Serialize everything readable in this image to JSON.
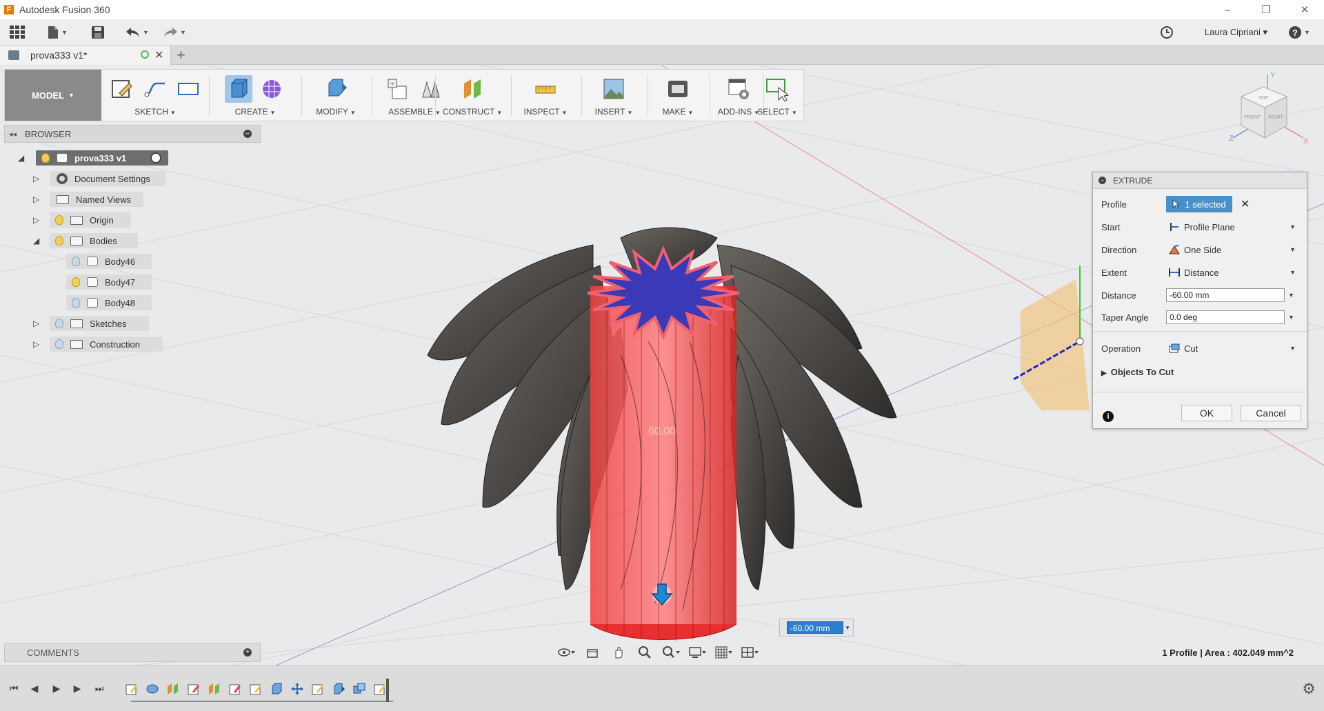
{
  "app": {
    "title": "Autodesk Fusion 360",
    "logo_letter": "F",
    "window_buttons": [
      "–",
      "❐",
      "✕"
    ]
  },
  "quickbar": {
    "user_name": "Laura Cipriani ▾",
    "icons": [
      "app-grid-icon",
      "file-icon",
      "save-icon",
      "undo-icon",
      "redo-icon",
      "job-status-icon",
      "help-icon"
    ]
  },
  "tab": {
    "label": "prova333 v1*",
    "new_tab": "+"
  },
  "ribbon": {
    "workspace": "MODEL",
    "groups": [
      {
        "id": "sketch",
        "label": "SKETCH"
      },
      {
        "id": "create",
        "label": "CREATE"
      },
      {
        "id": "modify",
        "label": "MODIFY"
      },
      {
        "id": "assemble",
        "label": "ASSEMBLE"
      },
      {
        "id": "construct",
        "label": "CONSTRUCT"
      },
      {
        "id": "inspect",
        "label": "INSPECT"
      },
      {
        "id": "insert",
        "label": "INSERT"
      },
      {
        "id": "make",
        "label": "MAKE"
      },
      {
        "id": "addins",
        "label": "ADD-INS"
      },
      {
        "id": "select",
        "label": "SELECT"
      }
    ]
  },
  "browser": {
    "title": "BROWSER",
    "root": "prova333 v1",
    "items": [
      {
        "label": "Document Settings"
      },
      {
        "label": "Named Views"
      },
      {
        "label": "Origin"
      },
      {
        "label": "Bodies"
      },
      {
        "label": "Body46"
      },
      {
        "label": "Body47"
      },
      {
        "label": "Body48"
      },
      {
        "label": "Sketches"
      },
      {
        "label": "Construction"
      }
    ]
  },
  "comments": {
    "title": "COMMENTS"
  },
  "extrude": {
    "title": "EXTRUDE",
    "profile": {
      "label": "Profile",
      "value": "1 selected"
    },
    "start": {
      "label": "Start",
      "value": "Profile Plane"
    },
    "direction": {
      "label": "Direction",
      "value": "One Side"
    },
    "extent": {
      "label": "Extent",
      "value": "Distance"
    },
    "distance": {
      "label": "Distance",
      "value": "-60.00 mm"
    },
    "taper": {
      "label": "Taper Angle",
      "value": "0.0 deg"
    },
    "operation": {
      "label": "Operation",
      "value": "Cut"
    },
    "objects_to_cut": "Objects To Cut",
    "ok": "OK",
    "cancel": "Cancel"
  },
  "manipulator": {
    "value": "-60.00 mm"
  },
  "viewport": {
    "ghost_dimension": "60.00"
  },
  "viewcube": {
    "faces": [
      "TOP",
      "FRONT",
      "RIGHT"
    ],
    "axes": [
      "Y",
      "Z",
      "X"
    ]
  },
  "status": {
    "text": "1 Profile | Area : 402.049 mm^2"
  },
  "colors": {
    "accent": "#4a90c8",
    "cut_red": "#e83030",
    "profile_blue": "#3a3ab8",
    "body_dark": "#4a4744",
    "plane_orange": "#f3c27a"
  }
}
